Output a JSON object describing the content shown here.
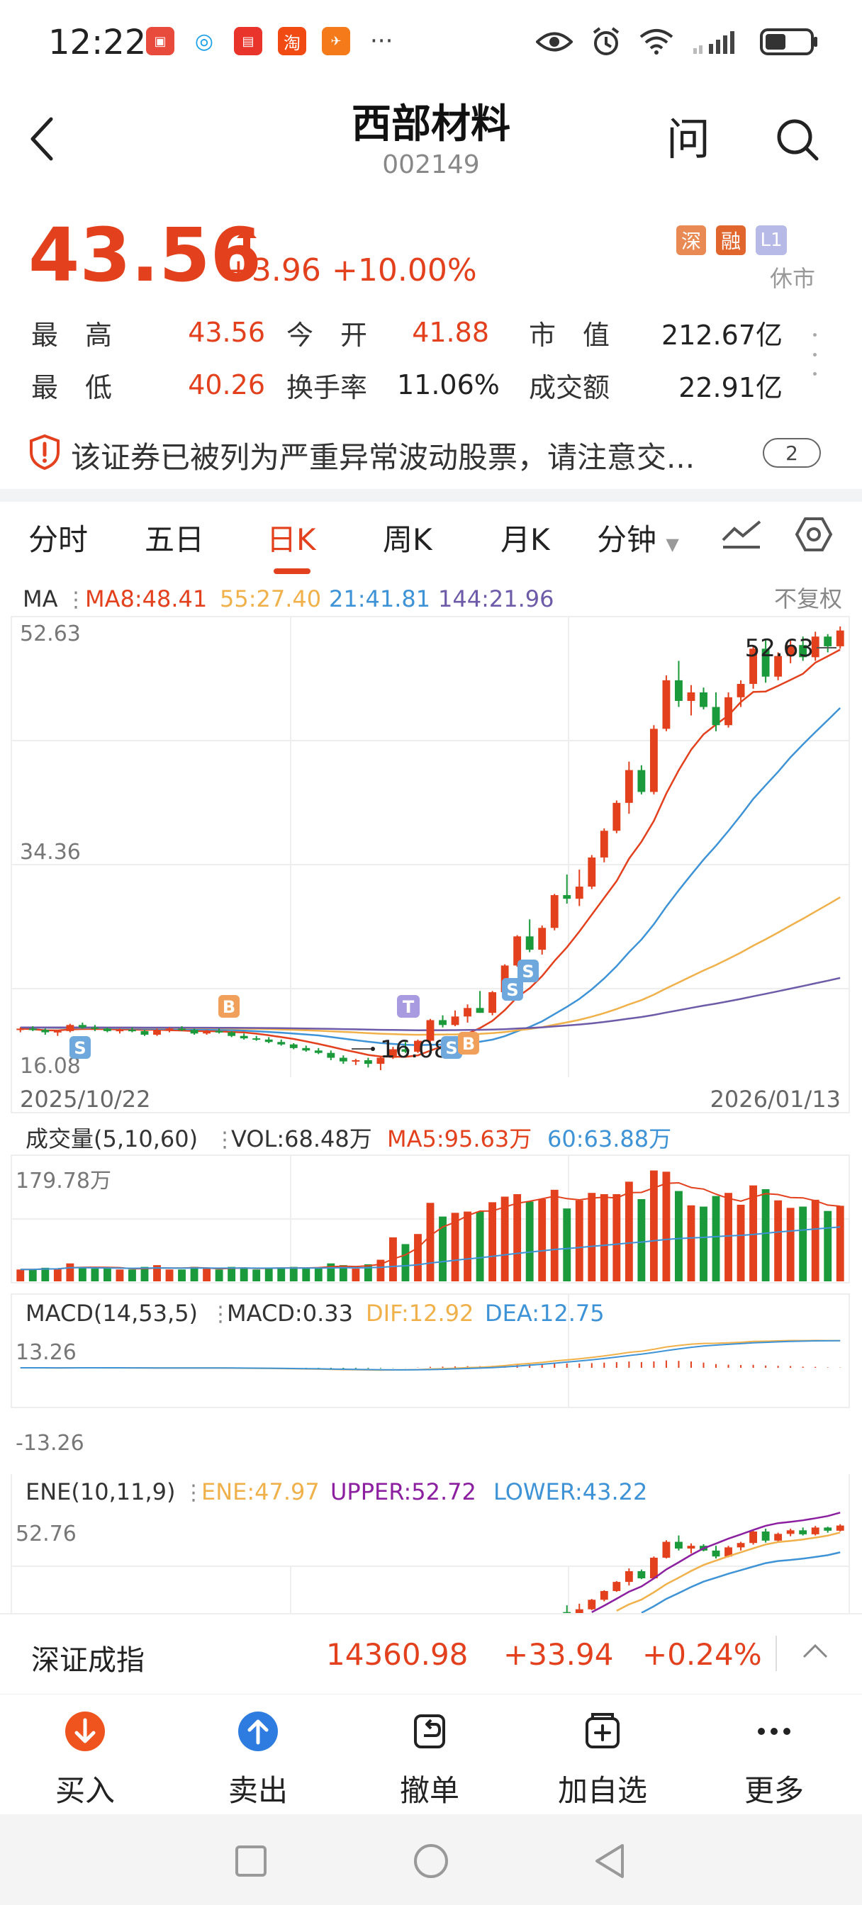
{
  "status_bar": {
    "time": "12:22",
    "notification_icons": [
      "huawei-store-icon",
      "chat-icon",
      "reader-icon",
      "taobao-icon",
      "mail-icon"
    ],
    "more": "···",
    "system_icons": [
      "eye-icon",
      "alarm-icon",
      "wifi-icon",
      "signal-icon",
      "battery-icon"
    ]
  },
  "header": {
    "title": "西部材料",
    "code": "002149",
    "ask_label": "问"
  },
  "quote": {
    "price": "43.56",
    "change": "+3.96",
    "change_pct": "+10.00%",
    "tags": [
      {
        "label": "深",
        "color": "#e98a55"
      },
      {
        "label": "融",
        "color": "#e0662e"
      },
      {
        "label": "L1",
        "color": "#b7b9e6"
      }
    ],
    "market_status": "休市",
    "rows": [
      [
        {
          "label": "最　高",
          "value": "43.56",
          "color": "#e3411e"
        },
        {
          "label": "今　开",
          "value": "41.88",
          "color": "#e3411e"
        },
        {
          "label": "市　值",
          "value": "212.67亿",
          "color": "#222222"
        }
      ],
      [
        {
          "label": "最　低",
          "value": "40.26",
          "color": "#e3411e"
        },
        {
          "label": "换手率",
          "value": "11.06%",
          "color": "#222222"
        },
        {
          "label": "成交额",
          "value": "22.91亿",
          "color": "#222222"
        }
      ]
    ]
  },
  "warning": {
    "text": "该证券已被列为严重异常波动股票，请注意交...",
    "count": "2"
  },
  "tabs": [
    "分时",
    "五日",
    "日K",
    "周K",
    "月K",
    "分钟"
  ],
  "active_tab": "日K",
  "chart_data": [
    {
      "type": "candlestick",
      "title": "MA",
      "indicators": [
        {
          "label": "MA8:48.41",
          "color": "#e3411e"
        },
        {
          "label": "55:27.40",
          "color": "#f0b04a"
        },
        {
          "label": "21:41.81",
          "color": "#3e93d6"
        },
        {
          "label": "144:21.96",
          "color": "#6d5aa8"
        }
      ],
      "adjust_label": "不复权",
      "y_labels": [
        "52.63",
        "34.36",
        "16.08"
      ],
      "ylim": [
        16.08,
        52.63
      ],
      "x_labels": [
        "2025/10/22",
        "2026/01/13"
      ],
      "max_label": "52.63",
      "min_label": "16.08",
      "markers": [
        "S",
        "B",
        "T",
        "S",
        "B",
        "S",
        "S"
      ],
      "candles": [
        [
          19.4,
          19.6,
          19.2,
          19.5
        ],
        [
          19.5,
          19.7,
          19.3,
          19.4
        ],
        [
          19.4,
          19.5,
          19.0,
          19.2
        ],
        [
          19.2,
          19.4,
          18.9,
          19.3
        ],
        [
          19.3,
          19.9,
          19.2,
          19.8
        ],
        [
          19.8,
          20.0,
          19.5,
          19.6
        ],
        [
          19.6,
          19.8,
          19.3,
          19.5
        ],
        [
          19.5,
          19.6,
          19.2,
          19.3
        ],
        [
          19.3,
          19.5,
          19.1,
          19.4
        ],
        [
          19.4,
          19.6,
          19.2,
          19.3
        ],
        [
          19.3,
          19.4,
          18.9,
          19.0
        ],
        [
          19.0,
          19.5,
          18.9,
          19.4
        ],
        [
          19.4,
          19.6,
          19.2,
          19.5
        ],
        [
          19.5,
          19.7,
          19.3,
          19.4
        ],
        [
          19.4,
          19.5,
          19.0,
          19.1
        ],
        [
          19.1,
          19.4,
          19.0,
          19.3
        ],
        [
          19.3,
          19.5,
          19.1,
          19.2
        ],
        [
          19.2,
          19.3,
          18.8,
          18.9
        ],
        [
          18.9,
          19.1,
          18.6,
          18.7
        ],
        [
          18.7,
          18.9,
          18.5,
          18.6
        ],
        [
          18.6,
          18.8,
          18.3,
          18.4
        ],
        [
          18.4,
          18.6,
          18.1,
          18.2
        ],
        [
          18.2,
          18.3,
          17.8,
          17.9
        ],
        [
          17.9,
          18.1,
          17.6,
          17.7
        ],
        [
          17.7,
          17.9,
          17.4,
          17.5
        ],
        [
          17.5,
          17.7,
          16.9,
          17.1
        ],
        [
          17.1,
          17.3,
          16.6,
          16.8
        ],
        [
          16.8,
          17.0,
          16.5,
          16.9
        ],
        [
          16.9,
          17.1,
          16.3,
          16.6
        ],
        [
          16.6,
          17.2,
          16.08,
          17.1
        ],
        [
          17.1,
          18.0,
          17.0,
          17.8
        ],
        [
          17.8,
          18.4,
          17.5,
          17.6
        ],
        [
          17.6,
          18.6,
          17.5,
          18.5
        ],
        [
          18.5,
          20.3,
          18.4,
          20.2
        ],
        [
          20.2,
          20.6,
          19.6,
          19.8
        ],
        [
          19.8,
          21.0,
          19.7,
          20.5
        ],
        [
          20.5,
          21.5,
          20.0,
          21.2
        ],
        [
          21.2,
          22.6,
          20.8,
          20.8
        ],
        [
          20.8,
          22.6,
          20.6,
          22.5
        ],
        [
          22.5,
          24.8,
          22.4,
          24.7
        ],
        [
          24.7,
          27.2,
          24.6,
          27.1
        ],
        [
          27.1,
          28.5,
          25.8,
          26.0
        ],
        [
          26.0,
          28.0,
          25.6,
          27.8
        ],
        [
          27.8,
          30.6,
          27.6,
          30.5
        ],
        [
          30.5,
          32.2,
          29.8,
          30.2
        ],
        [
          30.2,
          32.6,
          29.6,
          31.2
        ],
        [
          31.2,
          33.8,
          31.0,
          33.6
        ],
        [
          33.6,
          36.0,
          33.2,
          35.8
        ],
        [
          35.8,
          38.3,
          35.6,
          38.1
        ],
        [
          38.1,
          41.5,
          37.2,
          40.8
        ],
        [
          40.8,
          41.2,
          38.8,
          39.0
        ],
        [
          39.0,
          44.5,
          38.8,
          44.2
        ],
        [
          44.2,
          48.6,
          44.0,
          48.2
        ],
        [
          48.2,
          49.8,
          46.0,
          46.5
        ],
        [
          46.5,
          47.8,
          45.3,
          47.2
        ],
        [
          47.2,
          47.6,
          45.8,
          46.0
        ],
        [
          46.0,
          47.2,
          44.0,
          44.5
        ],
        [
          44.5,
          47.2,
          44.3,
          46.8
        ],
        [
          46.8,
          48.2,
          46.0,
          47.9
        ],
        [
          47.9,
          51.0,
          47.5,
          50.8
        ],
        [
          50.8,
          51.5,
          48.0,
          48.5
        ],
        [
          48.5,
          50.5,
          48.2,
          50.2
        ],
        [
          50.2,
          51.5,
          49.6,
          51.1
        ],
        [
          51.1,
          51.8,
          49.8,
          50.1
        ],
        [
          50.1,
          52.2,
          49.8,
          51.8
        ],
        [
          51.8,
          52.0,
          50.5,
          51.0
        ],
        [
          51.0,
          52.63,
          50.8,
          52.3
        ]
      ]
    },
    {
      "type": "bar",
      "title": "成交量(5,10,60)",
      "indicators": [
        {
          "label": "VOL:68.48万",
          "color": "#333333"
        },
        {
          "label": "MA5:95.63万",
          "color": "#e3411e"
        },
        {
          "label": "60:63.88万",
          "color": "#3e93d6"
        }
      ],
      "y_labels": [
        "179.78万"
      ],
      "ylim": [
        0,
        179.78
      ]
    },
    {
      "type": "line",
      "title": "MACD(14,53,5)",
      "indicators": [
        {
          "label": "MACD:0.33",
          "color": "#333333"
        },
        {
          "label": "DIF:12.92",
          "color": "#f0b04a"
        },
        {
          "label": "DEA:12.75",
          "color": "#3e93d6"
        }
      ],
      "y_labels": [
        "13.26",
        "-13.26"
      ],
      "ylim": [
        -13.26,
        13.26
      ]
    },
    {
      "type": "candlestick",
      "title": "ENE(10,11,9)",
      "indicators": [
        {
          "label": "ENE:47.97",
          "color": "#f0b04a"
        },
        {
          "label": "UPPER:52.72",
          "color": "#8b1fa0"
        },
        {
          "label": "LOWER:43.22",
          "color": "#3e93d6"
        }
      ],
      "y_labels": [
        "52.76"
      ]
    }
  ],
  "index_bar": {
    "name": "深证成指",
    "value": "14360.98",
    "change": "+33.94",
    "change_pct": "+0.24%"
  },
  "actions": [
    {
      "label": "买入",
      "icon": "buy-icon"
    },
    {
      "label": "卖出",
      "icon": "sell-icon"
    },
    {
      "label": "撤单",
      "icon": "cancel-order-icon"
    },
    {
      "label": "加自选",
      "icon": "add-watchlist-icon"
    },
    {
      "label": "更多",
      "icon": "more-icon"
    }
  ]
}
